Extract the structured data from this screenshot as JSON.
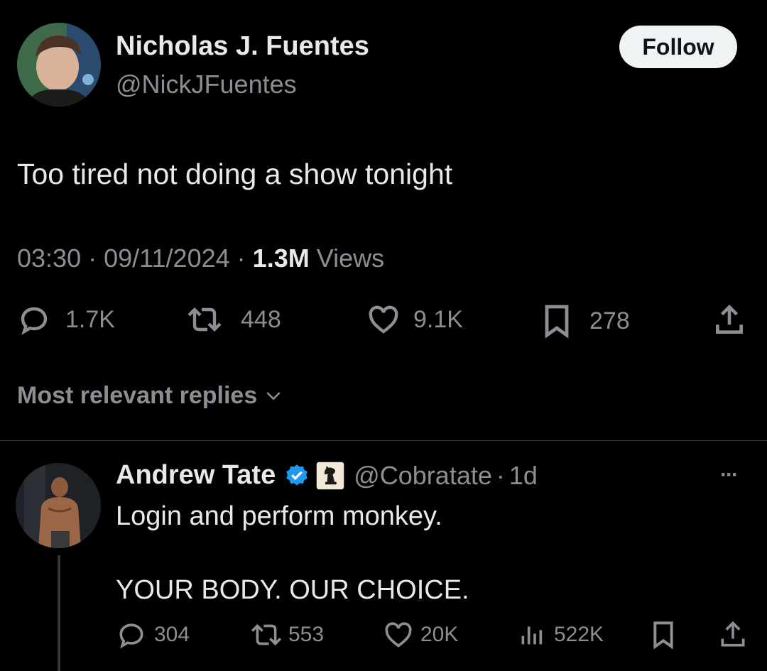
{
  "tweet": {
    "author_name": "Nicholas J. Fuentes",
    "author_handle": "@NickJFuentes",
    "follow_label": "Follow",
    "text": "Too tired not doing a show tonight",
    "time": "03:30",
    "sep1": "·",
    "date": "09/11/2024",
    "sep2": "·",
    "views_count": "1.3M",
    "views_label": "Views",
    "actions": {
      "replies": "1.7K",
      "reposts": "448",
      "likes": "9.1K",
      "bookmarks": "278"
    }
  },
  "replies_filter": {
    "label": "Most relevant replies"
  },
  "reply": {
    "author_name": "Andrew Tate",
    "author_handle": "@Cobratate",
    "sep": "·",
    "age": "1d",
    "line1": "Login and perform monkey.",
    "line2": "YOUR BODY. OUR CHOICE.",
    "more_label": "···",
    "actions": {
      "replies": "304",
      "reposts": "553",
      "likes": "20K",
      "views": "522K"
    }
  },
  "colors": {
    "background": "#000000",
    "text": "#e7e9ea",
    "muted": "#8b8f94",
    "verified": "#1d9bf0",
    "follow_bg": "#eff3f4"
  },
  "icons": [
    "reply-icon",
    "repost-icon",
    "like-icon",
    "bookmark-icon",
    "share-icon",
    "views-icon",
    "verified-badge-icon",
    "chess-knight-icon",
    "chevron-down-icon",
    "more-icon"
  ]
}
